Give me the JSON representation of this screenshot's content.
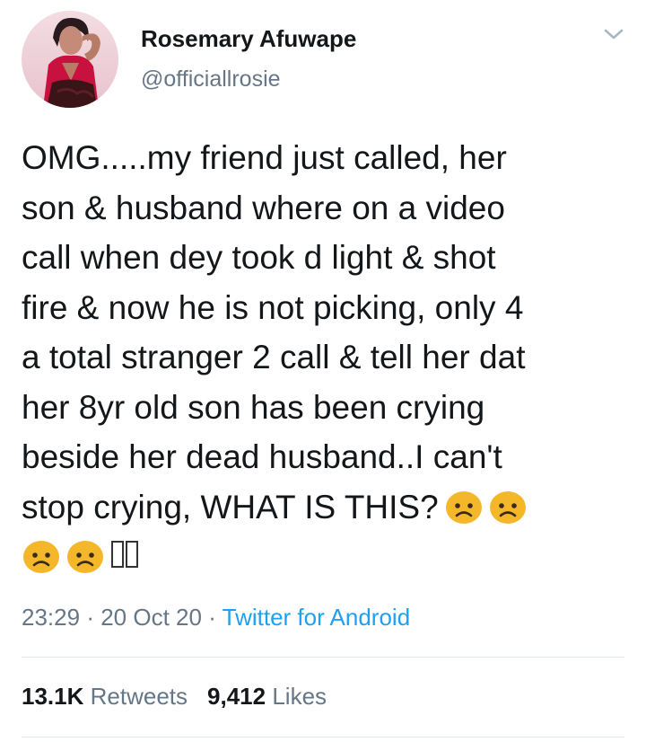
{
  "user": {
    "display_name": "Rosemary Afuwape",
    "handle": "@officiallrosie",
    "avatar_icon": "profile-photo"
  },
  "menu_icon": "chevron-down-icon",
  "tweet": {
    "lines": [
      "OMG.....my friend just called, her",
      "son & husband where on a video",
      "call when dey took d light & shot",
      "fire & now he is not picking, only 4",
      "a total stranger 2 call & tell her dat",
      "her 8yr old son has been crying",
      "beside her dead husband..I can't",
      "stop crying, WHAT IS THIS?"
    ],
    "emoji_name": "frowning-face-emoji"
  },
  "meta": {
    "time": "23:29",
    "separator": "·",
    "date": "20 Oct 20",
    "source": "Twitter for Android"
  },
  "stats": {
    "retweets_count": "13.1K",
    "retweets_label": "Retweets",
    "likes_count": "9,412",
    "likes_label": "Likes"
  },
  "colors": {
    "text": "#14171a",
    "secondary": "#657786",
    "link": "#1da1f2",
    "divider": "#e1e8ed",
    "emoji": "#f5b72a"
  }
}
